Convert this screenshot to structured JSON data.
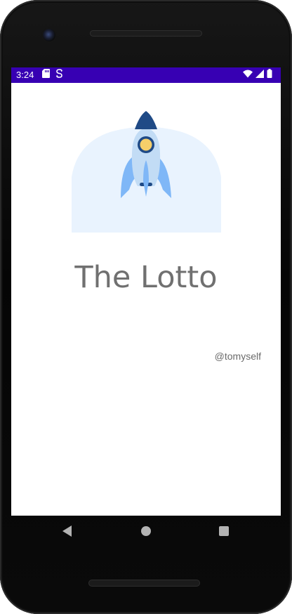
{
  "status_bar": {
    "time": "3:24",
    "background_color": "#3700b3",
    "left_icons": [
      "sd-card-icon",
      "sync-icon"
    ],
    "right_icons": [
      "wifi-icon",
      "signal-icon",
      "battery-icon"
    ]
  },
  "app": {
    "title": "The Lotto",
    "byline": "@tomyself",
    "hero_icon": "rocket-icon"
  },
  "nav_bar": {
    "buttons": [
      "back-icon",
      "home-icon",
      "recents-icon"
    ]
  }
}
